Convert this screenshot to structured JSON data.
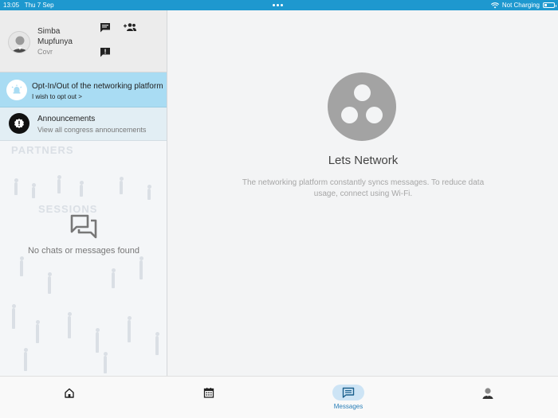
{
  "status_bar": {
    "time": "13:05",
    "date": "Thu 7 Sep",
    "charging": "Not Charging",
    "icons": [
      "wifi-icon",
      "battery-icon"
    ]
  },
  "profile": {
    "first_name": "Simba",
    "last_name": "Mupfunya",
    "organization": "Covr",
    "actions": [
      "new-chat-icon",
      "add-person-icon",
      "report-icon"
    ]
  },
  "opt_in": {
    "title": "Opt-In/Out of the networking platform",
    "subtitle": "I wish to opt out >"
  },
  "announcements": {
    "title": "Announcements",
    "subtitle": "View all congress announcements"
  },
  "background": {
    "words": [
      "PARTNERS",
      "SESSIONS"
    ]
  },
  "chat_list": {
    "empty_text": "No chats or messages found"
  },
  "main": {
    "title": "Lets Network",
    "description": "The networking platform constantly syncs messages. To reduce data usage, connect using Wi-Fi."
  },
  "tabs": [
    {
      "icon": "home-icon",
      "label": "",
      "active": false
    },
    {
      "icon": "calendar-icon",
      "label": "",
      "active": false
    },
    {
      "icon": "messages-icon",
      "label": "Messages",
      "active": true
    },
    {
      "icon": "profile-icon",
      "label": "",
      "active": false
    }
  ],
  "colors": {
    "status_bar": "#1e98cf",
    "opt_in_bg": "#a9dcf3",
    "active_tab": "#cde4f5",
    "active_tab_text": "#2a7fb8"
  }
}
